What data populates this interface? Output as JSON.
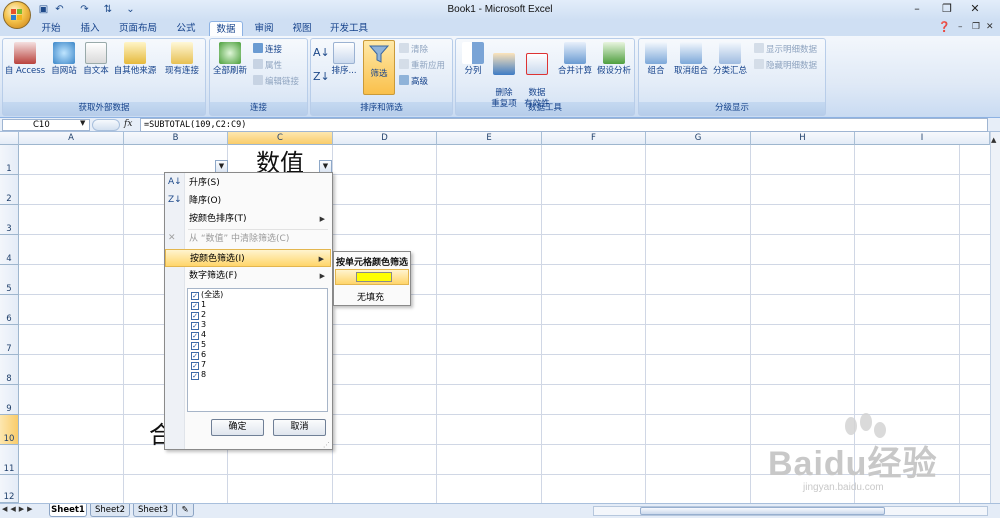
{
  "titlebar": {
    "title": "Book1 - Microsoft Excel"
  },
  "tabs": [
    "开始",
    "插入",
    "页面布局",
    "公式",
    "数据",
    "审阅",
    "视图",
    "开发工具"
  ],
  "active_tab": "数据",
  "ribbon": {
    "groups": {
      "external": {
        "label": "获取外部数据",
        "buttons": [
          "自 Access",
          "自网站",
          "自文本",
          "自其他来源",
          "现有连接"
        ]
      },
      "connections": {
        "label": "连接",
        "refresh": "全部刷新",
        "small": [
          "连接",
          "属性",
          "编辑链接"
        ]
      },
      "sortfilter": {
        "label": "排序和筛选",
        "sort": "排序...",
        "filter": "筛选",
        "small": [
          "清除",
          "重新应用",
          "高级"
        ]
      },
      "datatools": {
        "label": "数据工具",
        "buttons": [
          "分列",
          "删除\n重复项",
          "数据\n有效性",
          "合并计算",
          "假设分析"
        ]
      },
      "outline": {
        "label": "分级显示",
        "buttons": [
          "组合",
          "取消组合",
          "分类汇总"
        ],
        "small": [
          "显示明细数据",
          "隐藏明细数据"
        ]
      }
    }
  },
  "formula_bar": {
    "name_box": "C10",
    "fx": "fx",
    "formula": "=SUBTOTAL(109,C2:C9)"
  },
  "columns": [
    "A",
    "B",
    "C",
    "D",
    "E",
    "F",
    "G",
    "H",
    "I"
  ],
  "rows": [
    "1",
    "2",
    "3",
    "4",
    "5",
    "6",
    "7",
    "8",
    "9",
    "10",
    "11",
    "12"
  ],
  "selected_column": "C",
  "selected_row": "10",
  "cells": {
    "C1": "数值",
    "B10": "合"
  },
  "filter_menu": {
    "items": [
      {
        "label": "升序(S)",
        "enabled": true
      },
      {
        "label": "降序(O)",
        "enabled": true
      },
      {
        "label": "按颜色排序(T)",
        "enabled": true,
        "submenu": true
      },
      {
        "label": "从 “数值” 中清除筛选(C)",
        "enabled": false
      },
      {
        "label": "按颜色筛选(I)",
        "enabled": true,
        "submenu": true,
        "highlighted": true
      },
      {
        "label": "数字筛选(F)",
        "enabled": true,
        "submenu": true
      }
    ],
    "list": [
      "(全选)",
      "1",
      "2",
      "3",
      "4",
      "5",
      "6",
      "7",
      "8"
    ],
    "ok": "确定",
    "cancel": "取消"
  },
  "color_submenu": {
    "title": "按单元格颜色筛选",
    "swatch_color": "#ffff00",
    "no_fill": "无填充"
  },
  "sheets": [
    "Sheet1",
    "Sheet2",
    "Sheet3"
  ],
  "watermark": {
    "text": "Baidu经验",
    "url": "jingyan.baidu.com"
  },
  "colors": {
    "accent": "#15428b",
    "selected_header": "#f9cc6a",
    "menu_highlight": "#ffd56a"
  }
}
